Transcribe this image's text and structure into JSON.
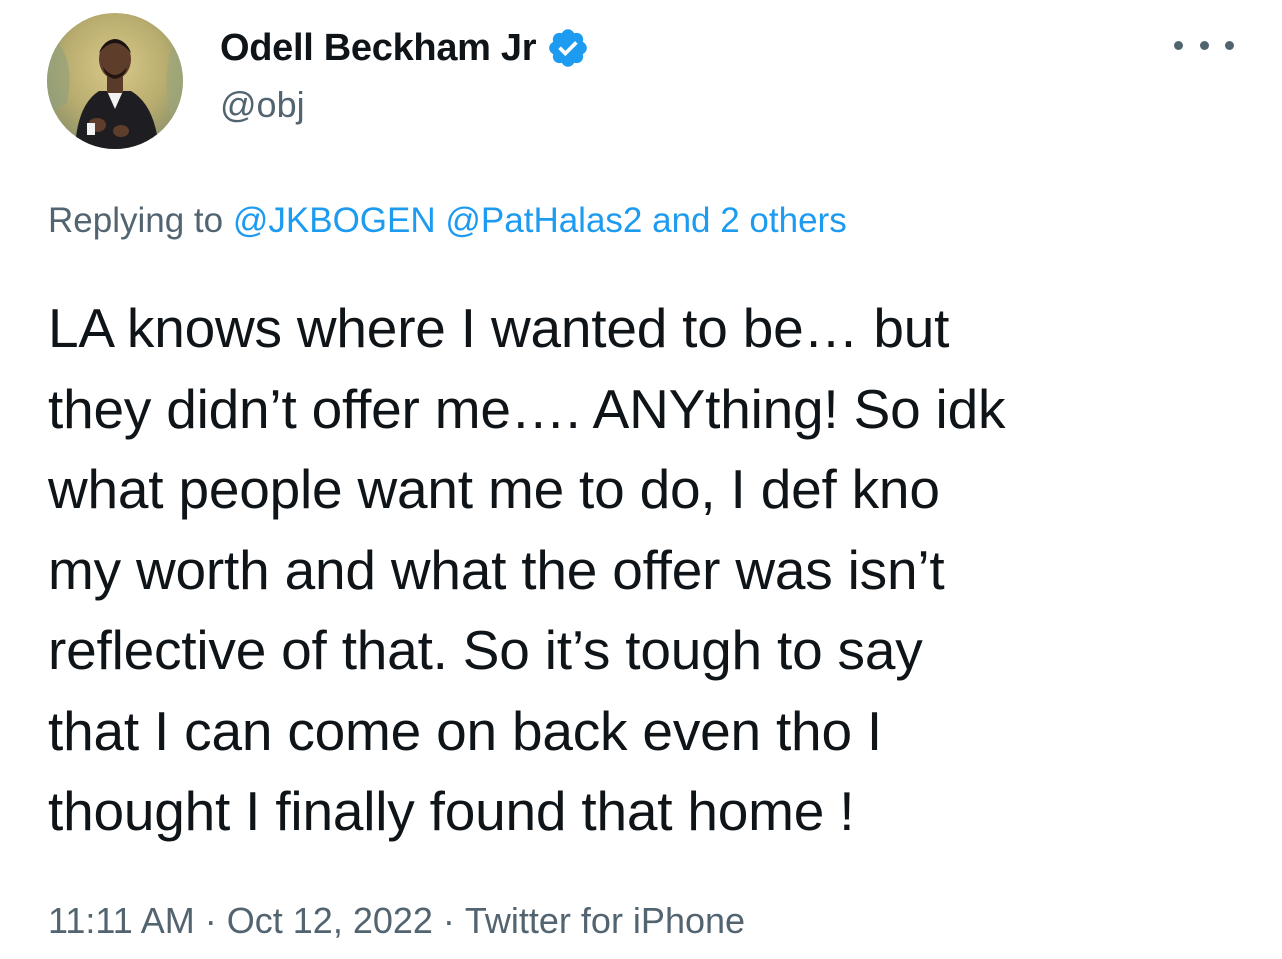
{
  "author": {
    "display_name": "Odell Beckham Jr",
    "handle": "@obj",
    "verified": true,
    "verified_color": "#1d9bf0"
  },
  "reply": {
    "prefix": "Replying to",
    "mentions": [
      "@JKBOGEN",
      "@PatHalas2"
    ],
    "others": "and 2 others"
  },
  "tweet": {
    "lines": [
      "LA knows where I wanted to be… but",
      "they didn’t offer me…. ANYthing! So idk",
      "what people want me to do, I def kno",
      "my worth and what the offer was isn’t",
      "reflective of that. So it’s tough to say",
      "that I can come on back even tho I",
      "thought I finally found that home !"
    ]
  },
  "meta": {
    "time": "11:11 AM",
    "date": "Oct 12, 2022",
    "source": "Twitter for iPhone",
    "separator": "·"
  },
  "icons": {
    "avatar": "profile-photo",
    "verified": "verified-badge-icon",
    "more": "more-options-icon"
  },
  "colors": {
    "text": "#0f1419",
    "secondary": "#536471",
    "link": "#1d9bf0"
  }
}
